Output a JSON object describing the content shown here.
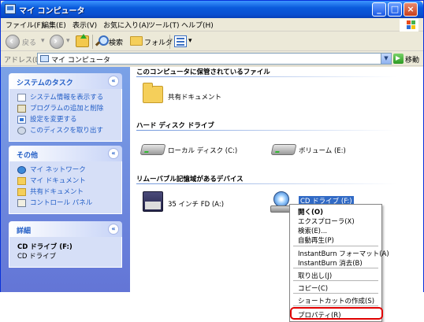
{
  "window": {
    "title": "マイ コンピュータ"
  },
  "menubar": {
    "items": [
      "ファイル(F)",
      "編集(E)",
      "表示(V)",
      "お気に入り(A)",
      "ツール(T)",
      "ヘルプ(H)"
    ]
  },
  "toolbar": {
    "back": "戻る",
    "search": "検索",
    "folders": "フォルダ"
  },
  "address": {
    "label": "アドレス(D)",
    "value": "マイ コンピュータ",
    "go": "移動"
  },
  "sidebar": {
    "system_tasks": {
      "title": "システムのタスク",
      "items": [
        "システム情報を表示する",
        "プログラムの追加と削除",
        "設定を変更する",
        "このディスクを取り出す"
      ]
    },
    "other_places": {
      "title": "その他",
      "items": [
        "マイ ネットワーク",
        "マイ ドキュメント",
        "共有ドキュメント",
        "コントロール パネル"
      ]
    },
    "details": {
      "title": "詳細",
      "name": "CD ドライブ (F:)",
      "type": "CD ドライブ"
    }
  },
  "main": {
    "groups": [
      {
        "title": "このコンピュータに保管されているファイル",
        "items": [
          "共有ドキュメント"
        ]
      },
      {
        "title": "ハード ディスク ドライブ",
        "items": [
          "ローカル ディスク (C:)",
          "ボリューム (E:)"
        ]
      },
      {
        "title": "リムーバブル記憶域があるデバイス",
        "items": [
          "35 インチ FD (A:)",
          "CD ドライブ (F:)"
        ]
      }
    ]
  },
  "context_menu": {
    "items": [
      "開く(O)",
      "エクスプローラ(X)",
      "検索(E)...",
      "自動再生(P)",
      "InstantBurn フォーマット(A)",
      "InstantBurn 消去(B)",
      "取り出し(J)",
      "コピー(C)",
      "ショートカットの作成(S)",
      "プロパティ(R)"
    ]
  }
}
